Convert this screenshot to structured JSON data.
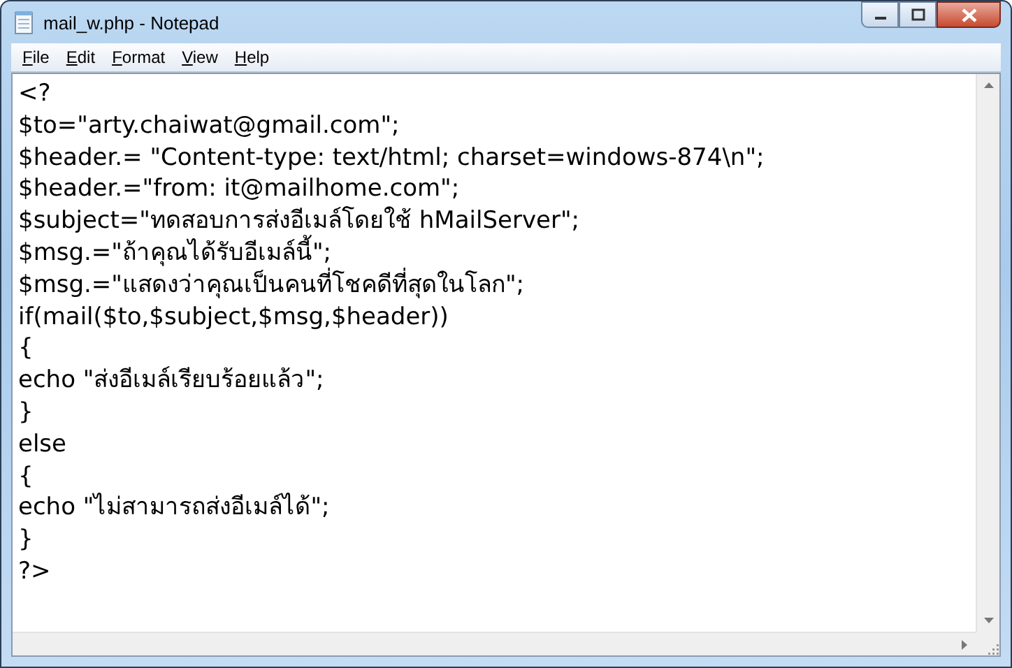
{
  "window": {
    "title": "mail_w.php - Notepad"
  },
  "menu": [
    {
      "label": "File"
    },
    {
      "label": "Edit"
    },
    {
      "label": "Format"
    },
    {
      "label": "View"
    },
    {
      "label": "Help"
    }
  ],
  "editor": {
    "lines": [
      "<?",
      "$to=\"arty.chaiwat@gmail.com\";",
      "$header.= \"Content-type: text/html; charset=windows-874\\n\";",
      "$header.=\"from: it@mailhome.com\";",
      "$subject=\"ทดสอบการส่งอีเมล์โดยใช้ hMailServer\";",
      "$msg.=\"ถ้าคุณได้รับอีเมล์นี้\";",
      "$msg.=\"แสดงว่าคุณเป็นคนที่โชคดีที่สุดในโลก\";",
      "if(mail($to,$subject,$msg,$header))",
      "{",
      "echo \"ส่งอีเมล์เรียบร้อยแล้ว\";",
      "}",
      "else",
      "{",
      "echo \"ไม่สามารถส่งอีเมล์ได้\";",
      "}",
      "?>"
    ]
  }
}
